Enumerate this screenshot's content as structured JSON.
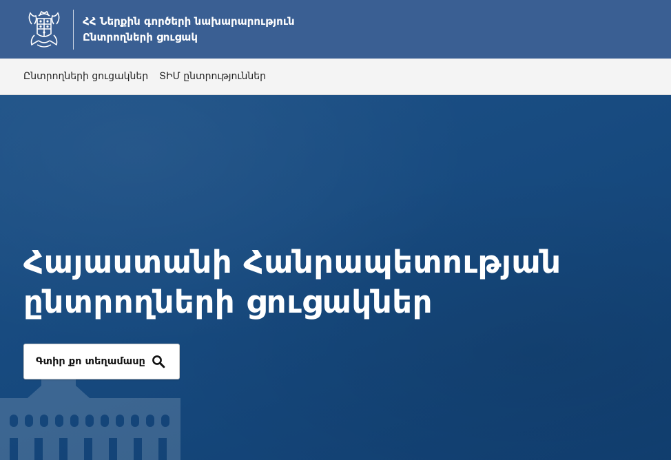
{
  "header": {
    "ministry": "ՀՀ Ներքին գործերի նախարարություն",
    "subtitle": "Ընտրողների ցուցակ",
    "logo_icon": "armenian-coat-of-arms-icon",
    "bg_color": "#3a5f93"
  },
  "nav": {
    "items": [
      {
        "label": "Ընտրողների ցուցակներ"
      },
      {
        "label": "ՏԻՄ ընտրություններ"
      }
    ]
  },
  "hero": {
    "title_line1": "Հայաստանի Հանրապետության",
    "title_line2": "ընտրողների ցուցակներ",
    "button_label": "Գտիր քո տեղամասը",
    "button_icon": "search-icon",
    "bg_color": "#174a7f"
  }
}
